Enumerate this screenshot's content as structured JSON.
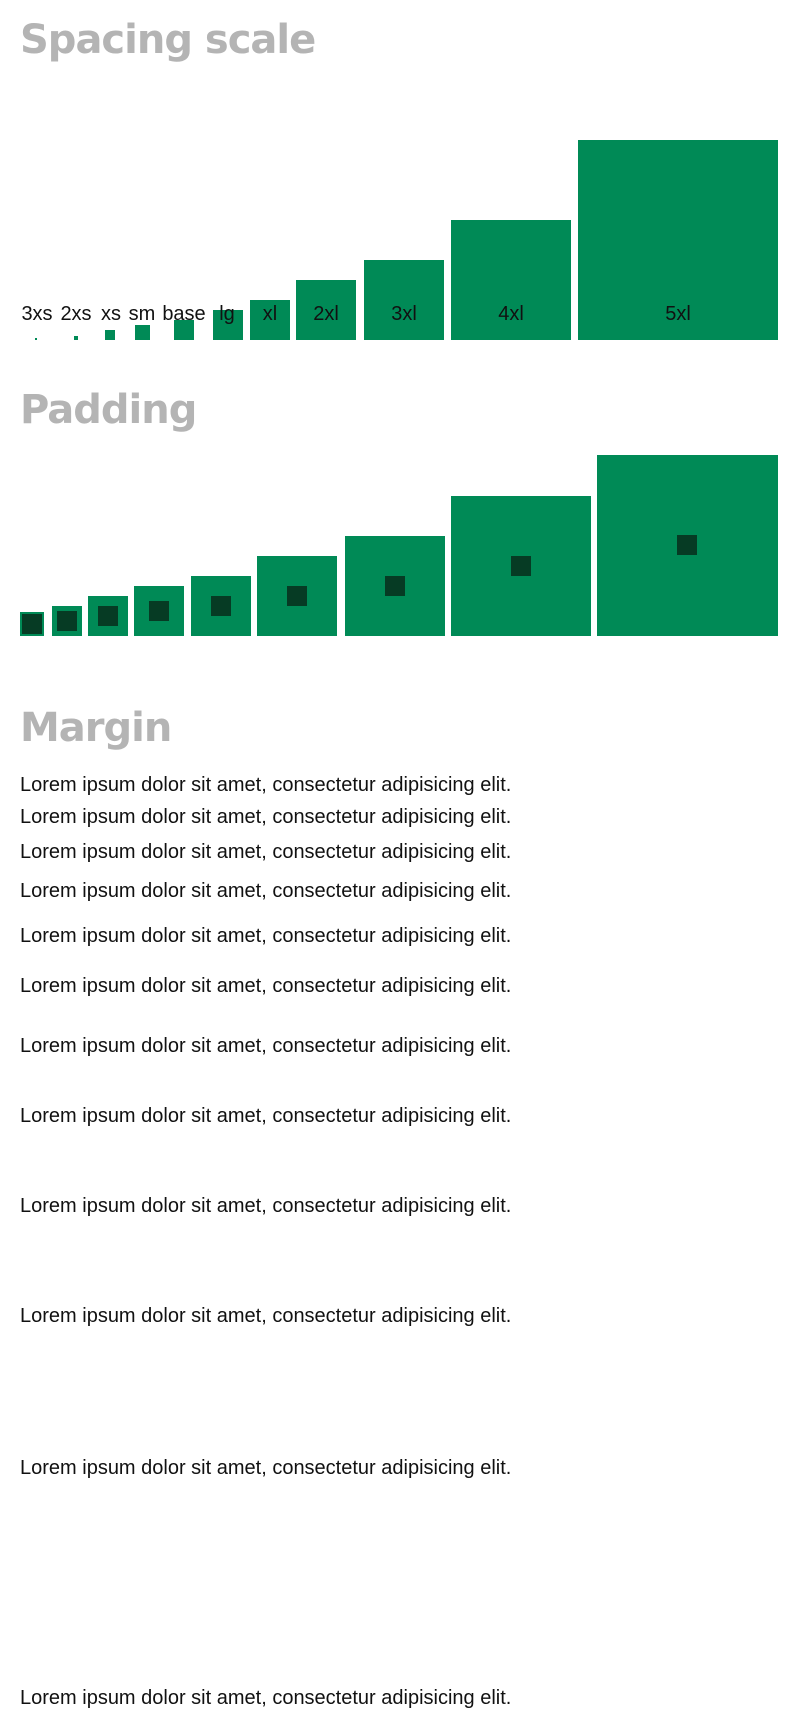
{
  "spacing_scale": {
    "title": "Spacing scale",
    "items": [
      {
        "label": "3xs"
      },
      {
        "label": "2xs"
      },
      {
        "label": "xs"
      },
      {
        "label": "sm"
      },
      {
        "label": "base"
      },
      {
        "label": "lg"
      },
      {
        "label": "xl"
      },
      {
        "label": "2xl"
      },
      {
        "label": "3xl"
      },
      {
        "label": "4xl"
      },
      {
        "label": "5xl"
      }
    ],
    "colors": {
      "box": "#008a56"
    }
  },
  "padding": {
    "title": "Padding",
    "colors": {
      "outer": "#008a56",
      "inner": "#063b24"
    }
  },
  "margin": {
    "title": "Margin",
    "items": [
      "Lorem ipsum dolor sit amet, consectetur adipisicing elit.",
      "Lorem ipsum dolor sit amet, consectetur adipisicing elit.",
      "Lorem ipsum dolor sit amet, consectetur adipisicing elit.",
      "Lorem ipsum dolor sit amet, consectetur adipisicing elit.",
      "Lorem ipsum dolor sit amet, consectetur adipisicing elit.",
      "Lorem ipsum dolor sit amet, consectetur adipisicing elit.",
      "Lorem ipsum dolor sit amet, consectetur adipisicing elit.",
      "Lorem ipsum dolor sit amet, consectetur adipisicing elit.",
      "Lorem ipsum dolor sit amet, consectetur adipisicing elit.",
      "Lorem ipsum dolor sit amet, consectetur adipisicing elit.",
      "Lorem ipsum dolor sit amet, consectetur adipisicing elit.",
      "Lorem ipsum dolor sit amet, consectetur adipisicing elit."
    ]
  }
}
